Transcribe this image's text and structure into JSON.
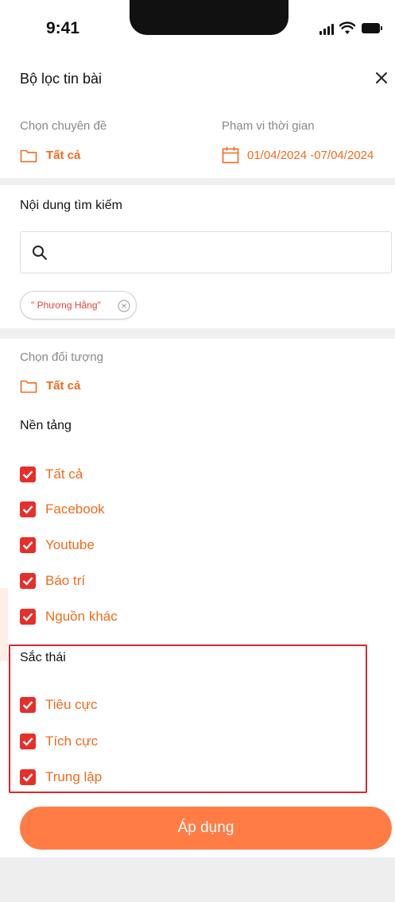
{
  "status_bar": {
    "time": "9:41"
  },
  "header": {
    "title": "Bộ lọc tin bài"
  },
  "topic": {
    "label": "Chọn chuyên đề",
    "value": "Tất cả"
  },
  "time_range": {
    "label": "Phạm vi thời gian",
    "value": "01/04/2024 -07/04/2024"
  },
  "search": {
    "heading": "Nội dung tìm kiếm",
    "value": "",
    "placeholder": ""
  },
  "chips": [
    {
      "label": "\" Phương Hằng\""
    }
  ],
  "target": {
    "label": "Chọn đối tượng",
    "value": "Tất cả"
  },
  "platform": {
    "heading": "Nền tảng",
    "options": [
      {
        "label": "Tất cả",
        "checked": true
      },
      {
        "label": "Facebook",
        "checked": true
      },
      {
        "label": "Youtube",
        "checked": true
      },
      {
        "label": "Báo trí",
        "checked": true
      },
      {
        "label": "Nguồn khác",
        "checked": true
      }
    ]
  },
  "sentiment": {
    "heading": "Sắc thái",
    "options": [
      {
        "label": "Tiêu cực",
        "checked": true
      },
      {
        "label": "Tích cực",
        "checked": true
      },
      {
        "label": "Trung lập",
        "checked": true
      }
    ]
  },
  "apply_label": "Áp dụng",
  "colors": {
    "accent": "#f26a1b",
    "checkbox": "#e62f2a",
    "button": "#ff7c45",
    "highlight": "#d9262f"
  }
}
